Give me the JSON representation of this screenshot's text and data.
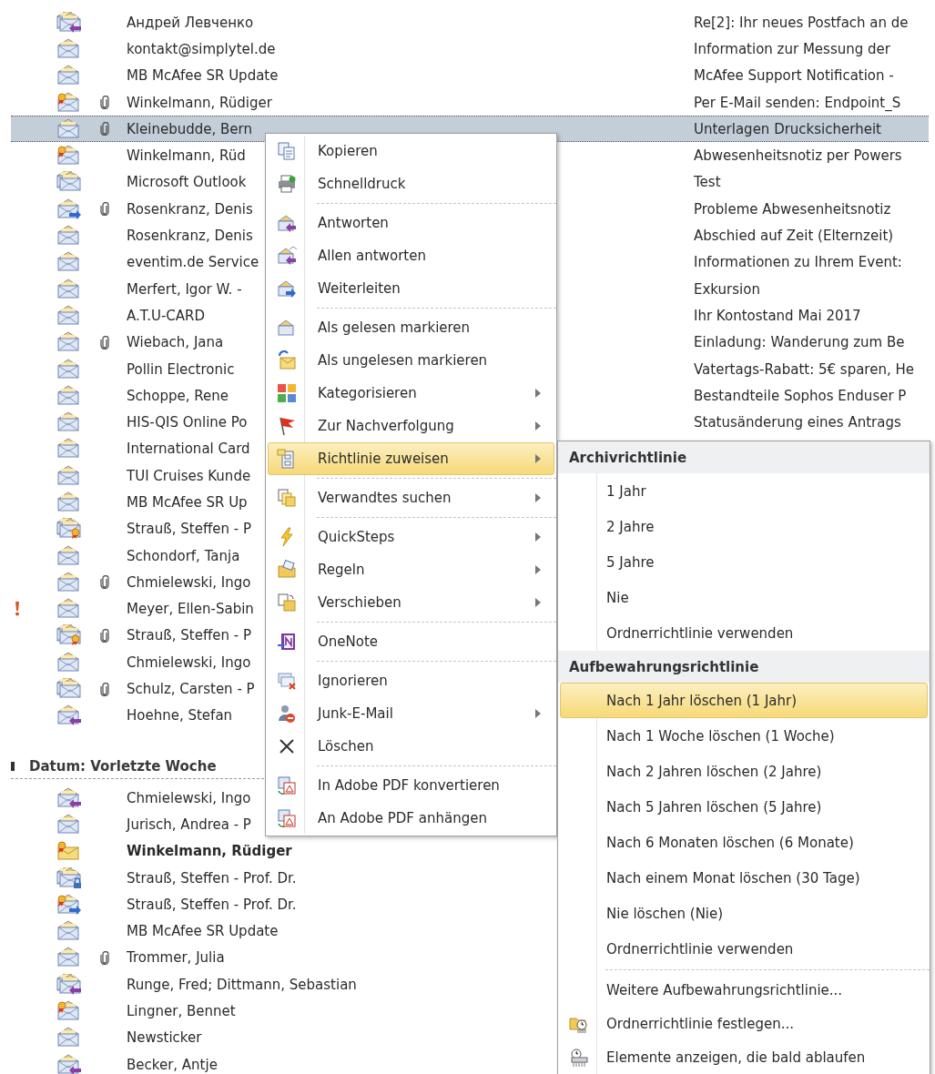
{
  "message_list": {
    "rows": [
      {
        "kind": "conversation_replied",
        "important": false,
        "attachment": false,
        "unread": false,
        "selected": false,
        "sender": "Андрей Левченко",
        "subject": "Re[2]: Ihr neues Postfach an de"
      },
      {
        "kind": "read",
        "important": false,
        "attachment": false,
        "unread": false,
        "selected": false,
        "sender": "kontakt@simplytel.de",
        "subject": "Information zur Messung der"
      },
      {
        "kind": "read",
        "important": false,
        "attachment": false,
        "unread": false,
        "selected": false,
        "sender": "MB McAfee SR Update",
        "subject": "McAfee Support Notification -"
      },
      {
        "kind": "signed",
        "important": false,
        "attachment": true,
        "unread": false,
        "selected": false,
        "sender": "Winkelmann, Rüdiger",
        "subject": "Per E-Mail senden: Endpoint_S"
      },
      {
        "kind": "read",
        "important": false,
        "attachment": true,
        "unread": false,
        "selected": true,
        "sender": "Kleinebudde, Bern",
        "subject": "Unterlagen Drucksicherheit"
      },
      {
        "kind": "signed",
        "important": false,
        "attachment": false,
        "unread": false,
        "selected": false,
        "sender": "Winkelmann, Rüd",
        "subject": "Abwesenheitsnotiz per Powers"
      },
      {
        "kind": "conversation",
        "important": false,
        "attachment": false,
        "unread": false,
        "selected": false,
        "sender": "Microsoft Outlook",
        "subject": "Test"
      },
      {
        "kind": "forwarded",
        "important": false,
        "attachment": true,
        "unread": false,
        "selected": false,
        "sender": "Rosenkranz, Denis",
        "subject": "Probleme Abwesenheitsnotiz"
      },
      {
        "kind": "read",
        "important": false,
        "attachment": false,
        "unread": false,
        "selected": false,
        "sender": "Rosenkranz, Denis",
        "subject": "Abschied auf Zeit (Elternzeit)"
      },
      {
        "kind": "read",
        "important": false,
        "attachment": false,
        "unread": false,
        "selected": false,
        "sender": "eventim.de Service",
        "subject": "Informationen zu Ihrem Event:"
      },
      {
        "kind": "read",
        "important": false,
        "attachment": false,
        "unread": false,
        "selected": false,
        "sender": "Merfert, Igor W. -",
        "subject": "Exkursion"
      },
      {
        "kind": "read",
        "important": false,
        "attachment": false,
        "unread": false,
        "selected": false,
        "sender": "A.T.U-CARD",
        "subject": "Ihr Kontostand Mai 2017"
      },
      {
        "kind": "read",
        "important": false,
        "attachment": true,
        "unread": false,
        "selected": false,
        "sender": "Wiebach, Jana",
        "subject": "Einladung: Wanderung zum Be"
      },
      {
        "kind": "read",
        "important": false,
        "attachment": false,
        "unread": false,
        "selected": false,
        "sender": "Pollin Electronic",
        "subject": "Vatertags-Rabatt: 5€ sparen, He"
      },
      {
        "kind": "read",
        "important": false,
        "attachment": false,
        "unread": false,
        "selected": false,
        "sender": "Schoppe, Rene",
        "subject": "Bestandteile Sophos Enduser P"
      },
      {
        "kind": "read",
        "important": false,
        "attachment": false,
        "unread": false,
        "selected": false,
        "sender": "HIS-QIS Online Po",
        "subject": "Statusänderung eines Antrags"
      },
      {
        "kind": "read",
        "important": false,
        "attachment": false,
        "unread": false,
        "selected": false,
        "sender": "International Card"
      },
      {
        "kind": "read",
        "important": false,
        "attachment": false,
        "unread": false,
        "selected": false,
        "sender": "TUI Cruises Kunde"
      },
      {
        "kind": "read",
        "important": false,
        "attachment": false,
        "unread": false,
        "selected": false,
        "sender": "MB McAfee SR Up"
      },
      {
        "kind": "conversation_signed",
        "important": false,
        "attachment": false,
        "unread": false,
        "selected": false,
        "sender": "Strauß, Steffen - P"
      },
      {
        "kind": "read",
        "important": false,
        "attachment": false,
        "unread": false,
        "selected": false,
        "sender": "Schondorf, Tanja"
      },
      {
        "kind": "read",
        "important": false,
        "attachment": true,
        "unread": false,
        "selected": false,
        "sender": "Chmielewski, Ingo"
      },
      {
        "kind": "read",
        "important": true,
        "attachment": false,
        "unread": false,
        "selected": false,
        "sender": "Meyer, Ellen-Sabin"
      },
      {
        "kind": "conversation_signed",
        "important": false,
        "attachment": true,
        "unread": false,
        "selected": false,
        "sender": "Strauß, Steffen - P"
      },
      {
        "kind": "read",
        "important": false,
        "attachment": false,
        "unread": false,
        "selected": false,
        "sender": "Chmielewski, Ingo"
      },
      {
        "kind": "conversation",
        "important": false,
        "attachment": true,
        "unread": false,
        "selected": false,
        "sender": "Schulz, Carsten - P"
      },
      {
        "kind": "replied",
        "important": false,
        "attachment": false,
        "unread": false,
        "selected": false,
        "sender": "Hoehne, Stefan"
      }
    ],
    "sections": [
      {
        "heading": "Datum: Vorletzte Woche",
        "rows": [
          {
            "kind": "replied",
            "important": false,
            "attachment": false,
            "unread": false,
            "selected": false,
            "sender": "Chmielewski, Ingo"
          },
          {
            "kind": "read",
            "important": false,
            "attachment": false,
            "unread": false,
            "selected": false,
            "sender": "Jurisch, Andrea - P"
          },
          {
            "kind": "signed_unread",
            "important": false,
            "attachment": false,
            "unread": true,
            "selected": false,
            "sender": "Winkelmann, Rüdiger"
          },
          {
            "kind": "conversation_locked",
            "important": false,
            "attachment": false,
            "unread": false,
            "selected": false,
            "sender": "Strauß, Steffen - Prof. Dr."
          },
          {
            "kind": "signed_forwarded",
            "important": false,
            "attachment": false,
            "unread": false,
            "selected": false,
            "sender": "Strauß, Steffen - Prof. Dr."
          },
          {
            "kind": "read",
            "important": false,
            "attachment": false,
            "unread": false,
            "selected": false,
            "sender": "MB McAfee SR Update"
          },
          {
            "kind": "read",
            "important": false,
            "attachment": true,
            "unread": false,
            "selected": false,
            "sender": "Trommer, Julia"
          },
          {
            "kind": "conversation_replied",
            "important": false,
            "attachment": false,
            "unread": false,
            "selected": false,
            "sender": "Runge, Fred;  Dittmann, Sebastian"
          },
          {
            "kind": "signed",
            "important": false,
            "attachment": false,
            "unread": false,
            "selected": false,
            "sender": "Lingner, Bennet"
          },
          {
            "kind": "read",
            "important": false,
            "attachment": false,
            "unread": false,
            "selected": false,
            "sender": "Newsticker"
          },
          {
            "kind": "replied",
            "important": false,
            "attachment": false,
            "unread": false,
            "selected": false,
            "sender": "Becker, Antje"
          }
        ]
      }
    ]
  },
  "context_menu": {
    "groups": [
      [
        {
          "kind": "copy",
          "label": "Kopieren",
          "submenu": false,
          "selected": false
        },
        {
          "kind": "print",
          "label": "Schnelldruck",
          "submenu": false,
          "selected": false
        }
      ],
      [
        {
          "kind": "reply",
          "label": "Antworten",
          "submenu": false,
          "selected": false
        },
        {
          "kind": "reply_all",
          "label": "Allen antworten",
          "submenu": false,
          "selected": false
        },
        {
          "kind": "forward",
          "label": "Weiterleiten",
          "submenu": false,
          "selected": false
        }
      ],
      [
        {
          "kind": "mark_read",
          "label": "Als gelesen markieren",
          "submenu": false,
          "selected": false
        },
        {
          "kind": "mark_unread",
          "label": "Als ungelesen markieren",
          "submenu": false,
          "selected": false
        },
        {
          "kind": "categorize",
          "label": "Kategorisieren",
          "submenu": true,
          "selected": false
        },
        {
          "kind": "follow_up",
          "label": "Zur Nachverfolgung",
          "submenu": true,
          "selected": false
        },
        {
          "kind": "policy",
          "label": "Richtlinie zuweisen",
          "submenu": true,
          "selected": true
        }
      ],
      [
        {
          "kind": "related",
          "label": "Verwandtes suchen",
          "submenu": true,
          "selected": false
        }
      ],
      [
        {
          "kind": "quicksteps",
          "label": "QuickSteps",
          "submenu": true,
          "selected": false
        },
        {
          "kind": "rules",
          "label": "Regeln",
          "submenu": true,
          "selected": false
        },
        {
          "kind": "move",
          "label": "Verschieben",
          "submenu": true,
          "selected": false
        }
      ],
      [
        {
          "kind": "onenote",
          "label": "OneNote",
          "submenu": false,
          "selected": false
        }
      ],
      [
        {
          "kind": "ignore",
          "label": "Ignorieren",
          "submenu": false,
          "selected": false
        },
        {
          "kind": "junk",
          "label": "Junk-E-Mail",
          "submenu": true,
          "selected": false
        },
        {
          "kind": "delete",
          "label": "Löschen",
          "submenu": false,
          "selected": false
        }
      ],
      [
        {
          "kind": "pdf_convert",
          "label": "In Adobe PDF konvertieren",
          "submenu": false,
          "selected": false
        },
        {
          "kind": "pdf_attach",
          "label": "An Adobe PDF anhängen",
          "submenu": false,
          "selected": false
        }
      ]
    ]
  },
  "policy_submenu": {
    "sections": [
      {
        "heading": "Archivrichtlinie",
        "items": [
          {
            "kind": "plain",
            "label": "1 Jahr",
            "selected": false
          },
          {
            "kind": "plain",
            "label": "2 Jahre",
            "selected": false
          },
          {
            "kind": "plain",
            "label": "5 Jahre",
            "selected": false
          },
          {
            "kind": "plain",
            "label": "Nie",
            "selected": false
          },
          {
            "kind": "plain",
            "label": "Ordnerrichtlinie verwenden",
            "selected": false
          }
        ]
      },
      {
        "heading": "Aufbewahrungsrichtlinie",
        "items": [
          {
            "kind": "plain",
            "label": "Nach 1 Jahr löschen (1 Jahr)",
            "selected": true
          },
          {
            "kind": "plain",
            "label": "Nach 1 Woche löschen (1 Woche)",
            "selected": false
          },
          {
            "kind": "plain",
            "label": "Nach 2 Jahren löschen (2 Jahre)",
            "selected": false
          },
          {
            "kind": "plain",
            "label": "Nach 5 Jahren löschen (5 Jahre)",
            "selected": false
          },
          {
            "kind": "plain",
            "label": "Nach 6 Monaten löschen (6 Monate)",
            "selected": false
          },
          {
            "kind": "plain",
            "label": "Nach einem Monat löschen (30 Tage)",
            "selected": false
          },
          {
            "kind": "plain",
            "label": "Nie löschen (Nie)",
            "selected": false
          },
          {
            "kind": "plain",
            "label": "Ordnerrichtlinie verwenden",
            "selected": false
          }
        ]
      },
      {
        "items": [
          {
            "kind": "plain",
            "label": "Weitere Aufbewahrungsrichtlinie...",
            "selected": false
          },
          {
            "kind": "folder_policy",
            "label": "Ordnerrichtlinie festlegen...",
            "selected": false
          },
          {
            "kind": "expiring",
            "label": "Elemente anzeigen, die bald ablaufen",
            "selected": false
          }
        ]
      }
    ]
  }
}
